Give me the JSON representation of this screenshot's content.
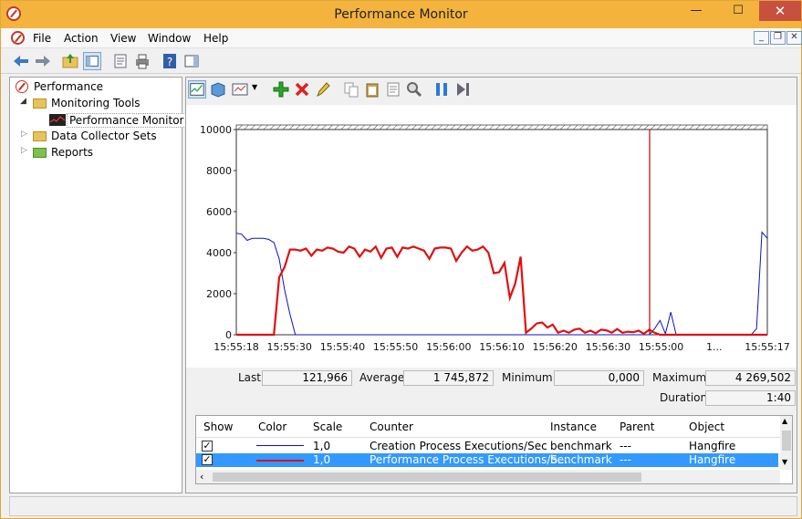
{
  "window": {
    "title": "Performance Monitor"
  },
  "menu": [
    "File",
    "Action",
    "View",
    "Window",
    "Help"
  ],
  "tree": {
    "root": "Performance",
    "monitoring_tools": "Monitoring Tools",
    "performance_monitor": "Performance Monitor",
    "data_collector_sets": "Data Collector Sets",
    "reports": "Reports"
  },
  "stats": {
    "last_label": "Last",
    "last": "121,966",
    "average_label": "Average",
    "average": "1 745,872",
    "minimum_label": "Minimum",
    "minimum": "0,000",
    "maximum_label": "Maximum",
    "maximum": "4 269,502",
    "duration_label": "Duration",
    "duration": "1:40"
  },
  "table": {
    "headers": [
      "Show",
      "Color",
      "Scale",
      "Counter",
      "Instance",
      "Parent",
      "Object"
    ],
    "rows": [
      {
        "show": "✓",
        "color": "#1010c0",
        "scale": "1,0",
        "counter": "Creation Process Executions/Sec",
        "instance": "benchmark",
        "parent": "---",
        "object": "Hangfire"
      },
      {
        "show": "✓",
        "color": "#e01010",
        "scale": "1,0",
        "counter": "Performance Process Executions/S...",
        "instance": "benchmark",
        "parent": "---",
        "object": "Hangfire"
      }
    ]
  },
  "chart_data": {
    "type": "line",
    "ylim": [
      0,
      10000
    ],
    "yticks": [
      "10000",
      "8000",
      "6000",
      "4000",
      "2000",
      "0"
    ],
    "xticks": [
      "15:55:18",
      "15:55:30",
      "15:55:40",
      "15:55:50",
      "15:56:00",
      "15:56:10",
      "15:56:20",
      "15:56:30",
      "15:55:00",
      "1...",
      "15:55:17"
    ],
    "grid": false,
    "series": [
      {
        "name": "Creation Process Executions/Sec",
        "color": "#1010c0",
        "values": [
          4950,
          4900,
          4600,
          4700,
          4700,
          4700,
          4650,
          4500,
          3700,
          2200,
          1000,
          0,
          0,
          0,
          0,
          0,
          0,
          0,
          0,
          0,
          0,
          0,
          0,
          0,
          0,
          0,
          0,
          0,
          0,
          0,
          0,
          0,
          0,
          0,
          0,
          0,
          0,
          0,
          0,
          0,
          0,
          0,
          0,
          0,
          0,
          0,
          0,
          0,
          0,
          0,
          0,
          0,
          0,
          0,
          0,
          0,
          0,
          0,
          0,
          0,
          0,
          0,
          0,
          0,
          0,
          0,
          0,
          0,
          0,
          0,
          0,
          0,
          0,
          0,
          0,
          0,
          0,
          0,
          300,
          700,
          50,
          1100,
          0,
          0,
          0,
          0,
          0,
          0,
          0,
          0,
          0,
          0,
          0,
          0,
          0,
          0,
          0,
          300,
          5000,
          4700
        ]
      },
      {
        "name": "Performance Process Executions/Sec",
        "color": "#e01010",
        "values": [
          0,
          0,
          0,
          0,
          0,
          0,
          0,
          0,
          2800,
          3300,
          4150,
          4150,
          4100,
          4200,
          3850,
          4150,
          4100,
          4250,
          4200,
          4050,
          4000,
          4300,
          4200,
          3800,
          4150,
          4050,
          4300,
          3750,
          4200,
          4250,
          3800,
          4250,
          4200,
          4300,
          4200,
          4100,
          3700,
          4200,
          4250,
          4250,
          4200,
          3600,
          4000,
          4300,
          4100,
          4150,
          4300,
          4000,
          3000,
          3050,
          3500,
          1800,
          2500,
          3800,
          100,
          300,
          550,
          600,
          350,
          500,
          100,
          200,
          100,
          250,
          300,
          100,
          200,
          80,
          250,
          220,
          100,
          280,
          100,
          150,
          120,
          200,
          50,
          250,
          100,
          0,
          0,
          0,
          0,
          0,
          0,
          0,
          0,
          0,
          0,
          0,
          0,
          0,
          0,
          0,
          0,
          0,
          0,
          0,
          0,
          0
        ]
      }
    ]
  },
  "colors": {
    "titlebar": "#f4b33d",
    "selection": "#3399ff",
    "current_time_line": "#c00000"
  }
}
